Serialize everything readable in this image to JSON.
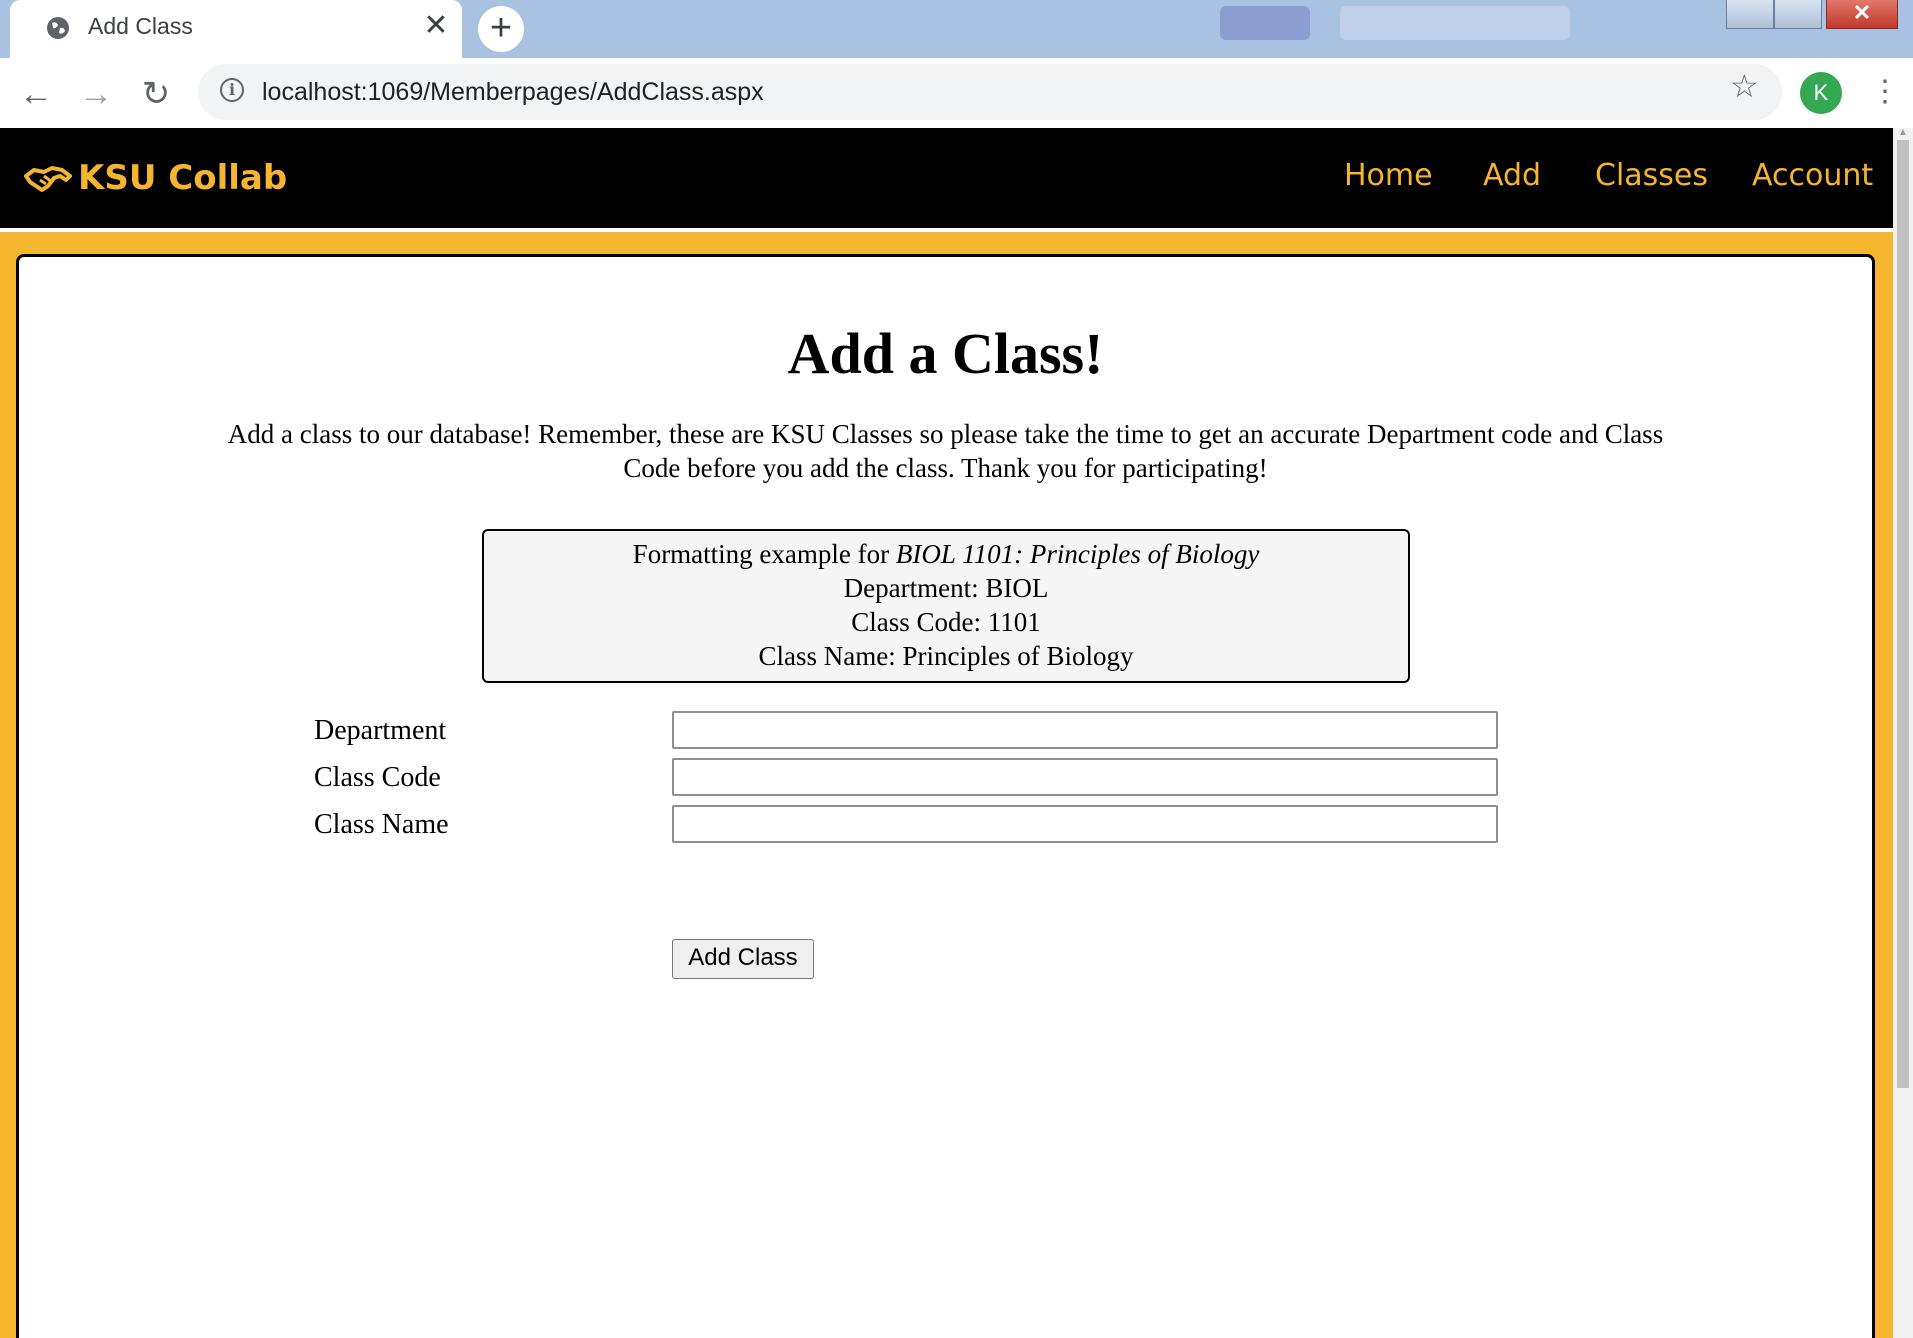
{
  "browser": {
    "tab_title": "Add Class",
    "tab_close": "✕",
    "new_tab": "+",
    "url": "localhost:1069/Memberpages/AddClass.aspx",
    "back": "←",
    "forward": "→",
    "reload": "↻",
    "info": "i",
    "star": "☆",
    "profile_initial": "K",
    "menu": "⋮",
    "window_close": "✕"
  },
  "site": {
    "brand": "KSU Collab",
    "brand_color": "#f5b52e",
    "nav": [
      "Home",
      "Add",
      "Classes",
      "Account"
    ]
  },
  "page": {
    "title": "Add a Class!",
    "intro": "Add a class to our database! Remember, these are KSU Classes so please take the time to get an accurate Department code and Class Code before you add the class. Thank you for participating!",
    "example": {
      "prefix": "Formatting example for ",
      "course": "BIOL 1101: Principles of Biology",
      "department": "Department: BIOL",
      "class_code": "Class Code: 1101",
      "class_name": "Class Name: Principles of Biology"
    },
    "form": {
      "department_label": "Department",
      "department_value": "",
      "class_code_label": "Class Code",
      "class_code_value": "",
      "class_name_label": "Class Name",
      "class_name_value": "",
      "submit_label": "Add Class"
    }
  }
}
